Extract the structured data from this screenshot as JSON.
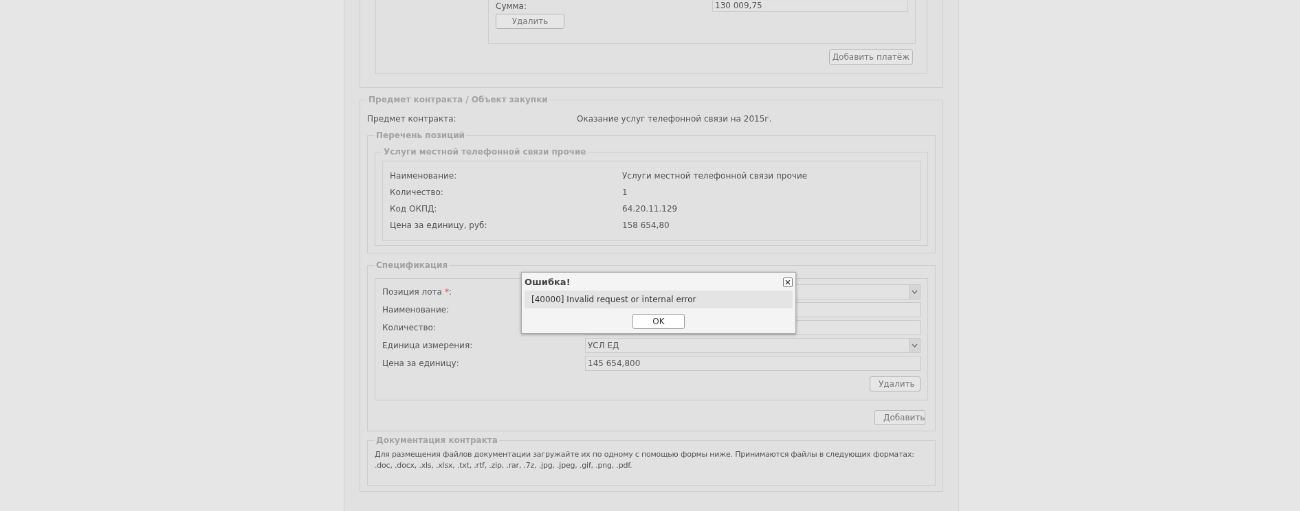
{
  "payment": {
    "label": "Сумма:",
    "value": "130 009,75",
    "delete_button": "Удалить",
    "add_button": "Добавить платёж"
  },
  "subject": {
    "legend": "Предмет контракта / Объект закупки",
    "label": "Предмет контракта:",
    "value": "Оказание услуг телефонной связи на 2015г.",
    "positions": {
      "legend": "Перечень позиций",
      "items": [
        {
          "legend": "Услуги местной телефонной связи прочие",
          "fields": [
            {
              "label": "Наименование:",
              "value": "Услуги местной телефонной связи прочие"
            },
            {
              "label": "Количество:",
              "value": "1"
            },
            {
              "label": "Код ОКПД:",
              "value": "64.20.11.129"
            },
            {
              "label": "Цена за единицу, руб:",
              "value": "158 654,80"
            }
          ]
        }
      ]
    }
  },
  "specification": {
    "legend": "Спецификация",
    "fields": [
      {
        "kind": "select",
        "label": "Позиция лота",
        "required_mark": "*",
        "suffix": ":"
      },
      {
        "kind": "input",
        "label": "Наименование:"
      },
      {
        "kind": "input",
        "label": "Количество:"
      },
      {
        "kind": "select",
        "label": "Единица измерения:",
        "value": "УСЛ ЕД"
      },
      {
        "kind": "input",
        "label": "Цена за единицу:",
        "value": "145 654,800"
      }
    ],
    "delete_button": "Удалить",
    "add_button": "Добавить"
  },
  "documentation": {
    "legend": "Документация контракта",
    "text": "Для размещения файлов документации загружайте их по одному с помощью формы ниже. Принимаются файлы в следующих форматах: .doc, .docx, .xls, .xlsx, .txt, .rtf, .zip, .rar, .7z, .jpg, .jpeg, .gif, .png, .pdf."
  },
  "dialog": {
    "title": "Ошибка!",
    "message": "[40000] Invalid request or internal error",
    "button": "OK"
  }
}
